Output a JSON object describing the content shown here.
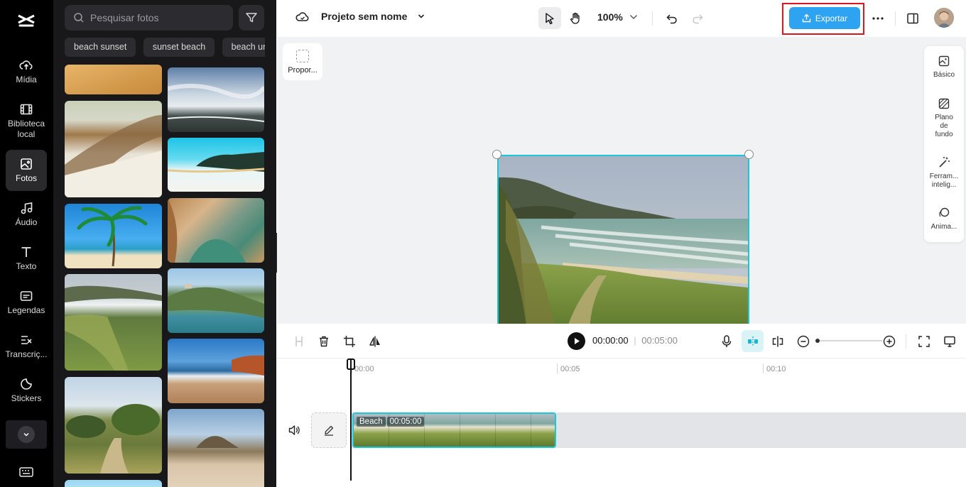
{
  "rail": {
    "items": [
      {
        "label": "Mídia",
        "icon": "cloud-upload-icon"
      },
      {
        "label": "Biblioteca local",
        "icon": "film-icon"
      },
      {
        "label": "Fotos",
        "icon": "image-icon",
        "active": true
      },
      {
        "label": "Áudio",
        "icon": "music-note-icon"
      },
      {
        "label": "Texto",
        "icon": "text-t-icon"
      },
      {
        "label": "Legendas",
        "icon": "captions-icon"
      },
      {
        "label": "Transcriç...",
        "icon": "transcript-icon"
      },
      {
        "label": "Stickers",
        "icon": "sticker-icon"
      }
    ]
  },
  "photos": {
    "search_placeholder": "Pesquisar fotos",
    "chips": [
      "beach sunset",
      "sunset beach",
      "beach um"
    ]
  },
  "topbar": {
    "project_title": "Projeto sem nome",
    "zoom": "100%",
    "export_label": "Exportar"
  },
  "canvas": {
    "ratio_label": "Propor..."
  },
  "props": {
    "items": [
      "Básico",
      "Plano de fundo",
      "Ferram... intelig...",
      "Anima..."
    ]
  },
  "timeline": {
    "current_time": "00:00:00",
    "separator": "|",
    "duration": "00:05:00",
    "ruler": [
      "00:00",
      "00:05",
      "00:10"
    ],
    "clip_name": "Beach",
    "clip_duration": "00:05:00"
  },
  "colors": {
    "accent": "#2ea3f2",
    "selection": "#19c8d8",
    "highlight": "#e0141e"
  }
}
